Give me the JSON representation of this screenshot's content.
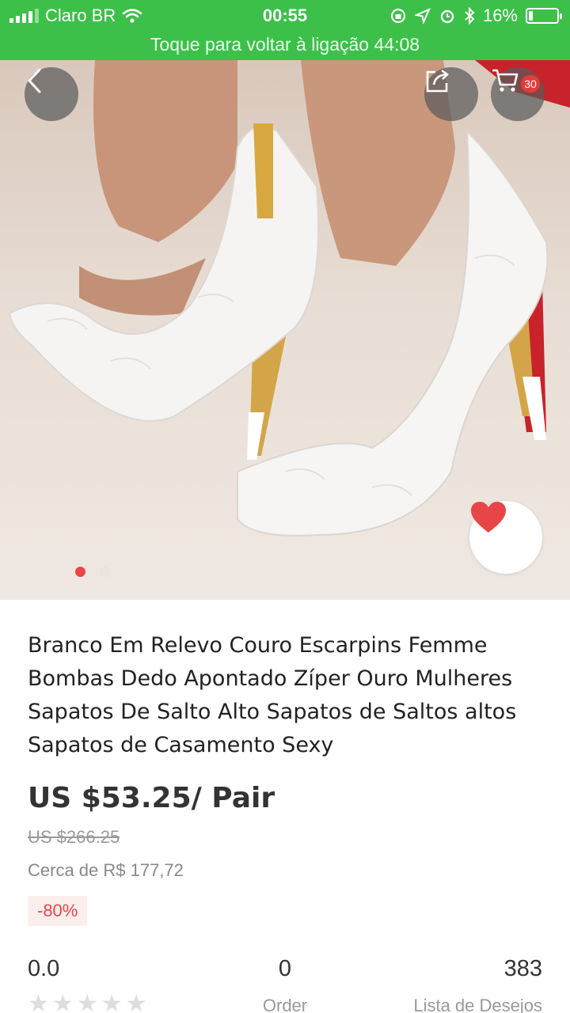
{
  "status_bar": {
    "carrier": "Claro BR",
    "time": "00:55",
    "battery": "16%",
    "battery_level": 0.16
  },
  "call_banner": "Toque para voltar à ligação 44:08",
  "gallery": {
    "cart_count": "30",
    "image_count": 2,
    "active_index": 0
  },
  "product": {
    "title": "Branco Em Relevo Couro Escarpins Femme Bombas Dedo Apontado Zíper Ouro Mulheres Sapatos De Salto Alto Sapatos de Saltos altos Sapatos de Casamento Sexy",
    "price": "US $53.25/ Pair",
    "original_price": "US $266.25",
    "approx_price": "Cerca de R$ 177,72",
    "discount": "-80%"
  },
  "stats": {
    "rating": "0.0",
    "stars_filled": 0,
    "orders": "0",
    "orders_label": "Order",
    "wishlist": "383",
    "wishlist_label": "Lista de Desejos"
  },
  "colors": {
    "status_green": "#3cc04a",
    "accent_red": "#e84646"
  }
}
